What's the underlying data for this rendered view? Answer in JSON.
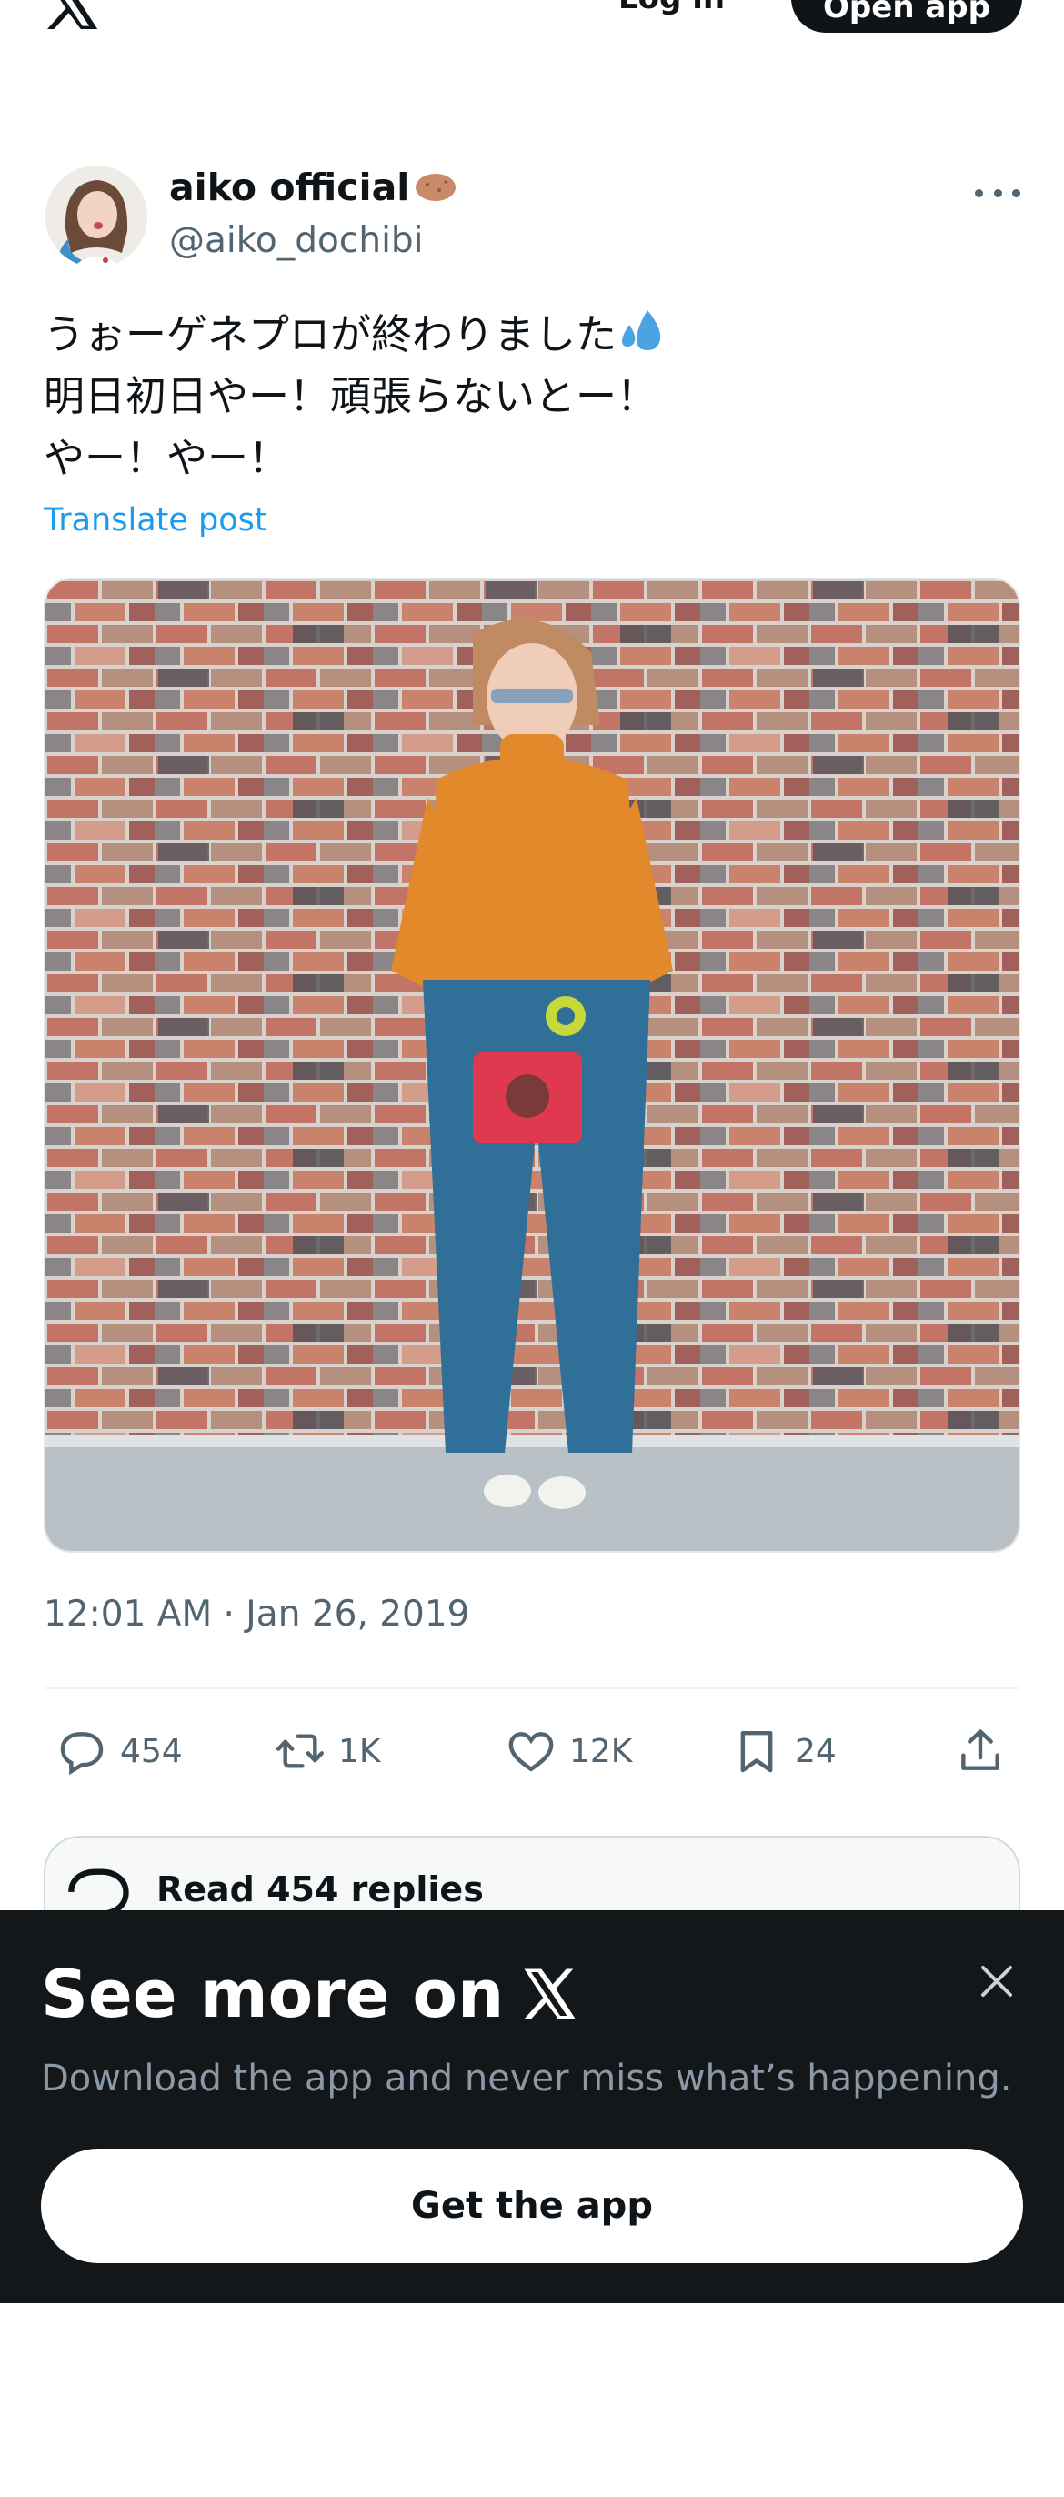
{
  "header": {
    "logo_icon": "x-logo-icon",
    "login_label": "Log in",
    "open_app_label": "Open app"
  },
  "post": {
    "author_name": "aiko official",
    "author_emoji": "potato-emoji",
    "author_handle": "@aiko_dochibi",
    "text_lines": [
      "うぉーゲネプロが終わりました",
      "明日初日やー！頑張らないとー！",
      "やー！やー！"
    ],
    "text_emoji": "sweat-droplets-emoji",
    "translate_label": "Translate post",
    "timestamp": "12:01 AM · Jan 26, 2019"
  },
  "actions": {
    "replies": "454",
    "reposts": "1K",
    "likes": "12K",
    "bookmarks": "24"
  },
  "read_replies_label": "Read 454 replies",
  "sheet": {
    "title": "See more on",
    "subtitle": "Download the app and never miss what’s happening.",
    "button_label": "Get the app"
  },
  "colors": {
    "accent": "#1d9bf0",
    "text": "#0f1419",
    "muted": "#536471",
    "sheet_bg": "#14171a"
  }
}
